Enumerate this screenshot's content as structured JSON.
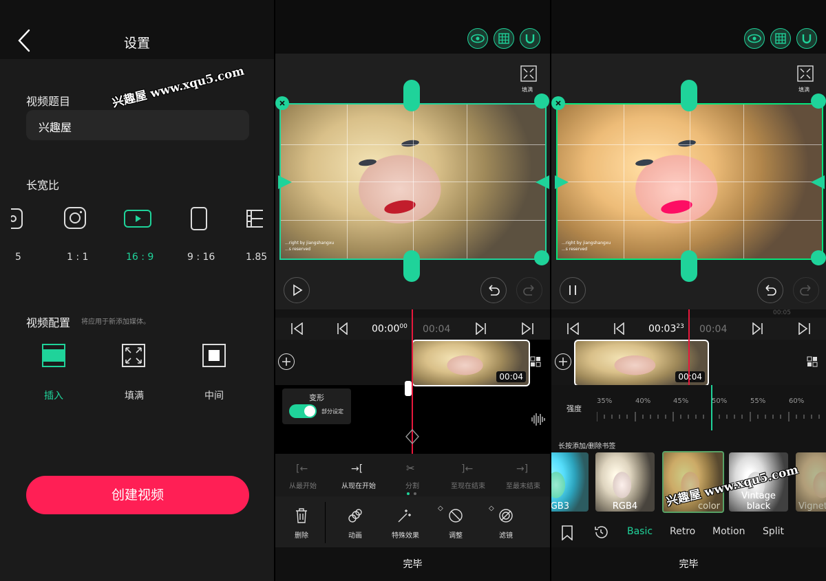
{
  "panel1": {
    "title": "设置",
    "video_title_label": "视频题目",
    "video_title_value": "兴趣屋",
    "aspect_label": "长宽比",
    "aspect_ratios": [
      {
        "label": "5",
        "icon": "portrait-partial-icon"
      },
      {
        "label": "1 : 1",
        "icon": "instagram-icon"
      },
      {
        "label": "16 : 9",
        "icon": "youtube-icon",
        "active": true
      },
      {
        "label": "9 : 16",
        "icon": "phone-portrait-icon"
      },
      {
        "label": "1.85",
        "icon": "film-icon"
      }
    ],
    "video_config_label": "视频配置",
    "video_config_hint": "将应用于新添加媒体。",
    "config_options": [
      {
        "label": "插入",
        "active": true
      },
      {
        "label": "填满"
      },
      {
        "label": "中间"
      }
    ],
    "create_button": "创建视频",
    "watermark": "兴趣屋 www.xqu5.com"
  },
  "panel2": {
    "fill_label": "填满",
    "photo_credit_1": "...right by jiangshangxu",
    "photo_credit_2": "...s reserved",
    "time_current": "00:00",
    "time_current_sub": "00",
    "time_end": "00:04",
    "clip_duration": "00:04",
    "transform_title": "变形",
    "transform_toggle_label": "部分设定",
    "trim_tools": [
      "从最开始",
      "从现在开始",
      "分割",
      "至现在结束",
      "至最末结束"
    ],
    "edit_tools": [
      "删除",
      "动画",
      "特殊效果",
      "调整",
      "滤镜"
    ],
    "done": "完毕"
  },
  "panel3": {
    "fill_label": "填满",
    "photo_credit_1": "...right by jiangshangxu",
    "photo_credit_2": "...s reserved",
    "timeline_mark": "00:05",
    "time_current": "00:03",
    "time_current_sub": "23",
    "time_end": "00:04",
    "clip_duration": "00:04",
    "intensity_label": "强度",
    "intensity_ticks": [
      "35%",
      "40%",
      "45%",
      "50%",
      "55%",
      "60%"
    ],
    "bookmark_hint": "长按添加/删除书签",
    "filters": [
      {
        "label": "GB3",
        "partial": true
      },
      {
        "label": "RGB4"
      },
      {
        "label": "color",
        "active": true
      },
      {
        "label": "Vintage black"
      },
      {
        "label": "Vignette",
        "partial": true
      }
    ],
    "tabs": [
      "Basic",
      "Retro",
      "Motion",
      "Split"
    ],
    "active_tab": "Basic",
    "done": "完毕",
    "watermark": "兴趣屋 www.xqu5.com"
  },
  "colors": {
    "accent": "#1fd39a",
    "create_button": "#ff1f55",
    "playhead": "#e8183c"
  }
}
